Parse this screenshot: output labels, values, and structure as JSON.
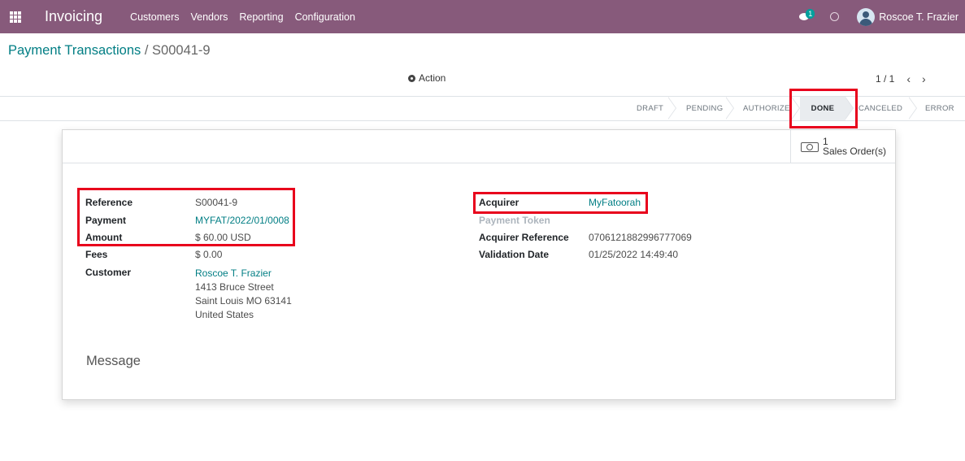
{
  "navbar": {
    "app_name": "Invoicing",
    "menu": [
      "Customers",
      "Vendors",
      "Reporting",
      "Configuration"
    ],
    "chat_badge": "1",
    "user_name": "Roscoe T. Frazier"
  },
  "control_panel": {
    "breadcrumb_parent": "Payment Transactions",
    "breadcrumb_separator": "/",
    "breadcrumb_current": "S00041-9",
    "action_label": "Action",
    "pager_value": "1 / 1",
    "pager_prev": "‹",
    "pager_next": "›"
  },
  "statusbar": {
    "stages": [
      "DRAFT",
      "PENDING",
      "AUTHORIZED",
      "DONE",
      "CANCELED",
      "ERROR"
    ],
    "current_stage": "DONE"
  },
  "smart_button": {
    "count": "1",
    "label": "Sales Order(s)"
  },
  "left_fields": {
    "reference_label": "Reference",
    "reference_value": "S00041-9",
    "payment_label": "Payment",
    "payment_value": "MYFAT/2022/01/0008",
    "amount_label": "Amount",
    "amount_value": "$ 60.00 USD",
    "fees_label": "Fees",
    "fees_value": "$ 0.00",
    "customer_label": "Customer",
    "customer_name": "Roscoe T. Frazier",
    "customer_address": [
      "1413 Bruce Street",
      "Saint Louis MO 63141",
      "United States"
    ]
  },
  "right_fields": {
    "acquirer_label": "Acquirer",
    "acquirer_value": "MyFatoorah",
    "payment_token_label": "Payment Token",
    "acquirer_reference_label": "Acquirer Reference",
    "acquirer_reference_value": "0706121882996777069",
    "validation_date_label": "Validation Date",
    "validation_date_value": "01/25/2022 14:49:40"
  },
  "message_title": "Message",
  "colors": {
    "navbar": "#875a7b",
    "link": "#017e84",
    "highlight": "#e8001c"
  }
}
